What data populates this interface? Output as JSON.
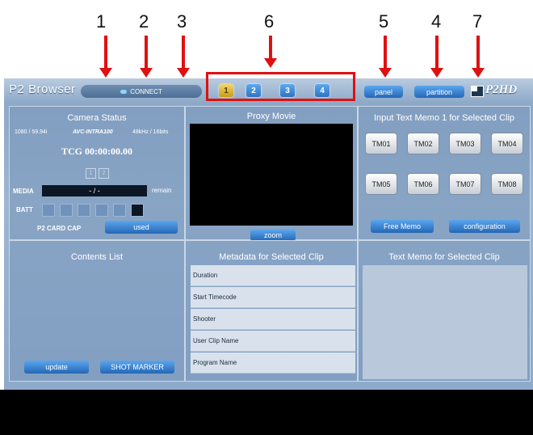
{
  "callouts": [
    "1",
    "2",
    "3",
    "6",
    "5",
    "4",
    "7"
  ],
  "app": {
    "title": "P2 Browser",
    "logo": "P2HD",
    "connect_label": "CONNECT",
    "cards": [
      "1",
      "2",
      "3",
      "4"
    ],
    "active_card": "1",
    "panel_label": "panel",
    "partition_label": "partition"
  },
  "camera_status": {
    "title": "Camera Status",
    "format": "1080 / 59.94i",
    "codec": "AVC-INTRA100",
    "audio": "48kHz / 16bits",
    "tcg": "TCG 00:00:00.00",
    "slots": [
      "1",
      "2"
    ],
    "media_label": "MEDIA",
    "media_value": "- / -",
    "remain_label": "remain",
    "batt_label": "BATT",
    "card_cap_label": "P2 CARD CAP",
    "used_label": "used"
  },
  "proxy": {
    "title": "Proxy Movie",
    "zoom_label": "zoom"
  },
  "text_memo_input": {
    "title": "Input Text Memo 1 for Selected Clip",
    "buttons": [
      "TM01",
      "TM02",
      "TM03",
      "TM04",
      "TM05",
      "TM06",
      "TM07",
      "TM08"
    ],
    "free_memo_label": "Free Memo",
    "configuration_label": "configuration"
  },
  "contents": {
    "title": "Contents List",
    "update_label": "update",
    "shot_marker_label": "SHOT MARKER"
  },
  "metadata": {
    "title": "Metadata for Selected Clip",
    "rows": [
      "Duration",
      "Start Timecode",
      "Shooter",
      "User Clip Name",
      "Program Name"
    ]
  },
  "text_memo_view": {
    "title": "Text Memo for Selected Clip"
  },
  "colors": {
    "callout_red": "#e01010",
    "active_card": "#e3bf3c",
    "button_blue": "#2b74c4"
  }
}
